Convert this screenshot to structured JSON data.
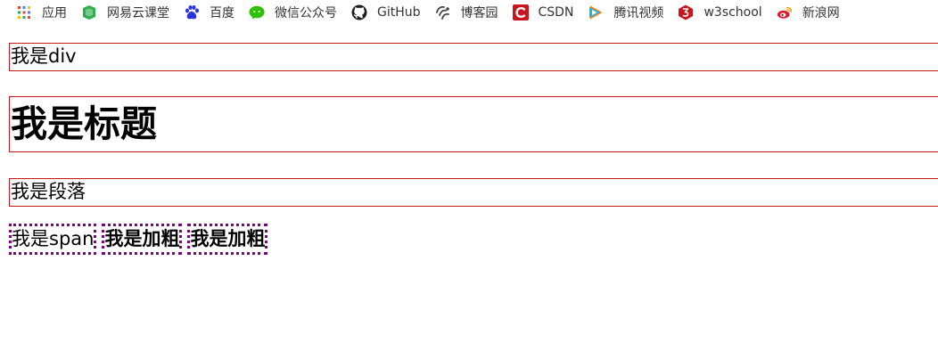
{
  "bookmarks": [
    {
      "label": "应用",
      "icon": "apps-grid-icon"
    },
    {
      "label": "网易云课堂",
      "icon": "netease-study-icon"
    },
    {
      "label": "百度",
      "icon": "baidu-paw-icon"
    },
    {
      "label": "微信公众号",
      "icon": "wechat-icon"
    },
    {
      "label": "GitHub",
      "icon": "github-icon"
    },
    {
      "label": "博客园",
      "icon": "cnblogs-icon"
    },
    {
      "label": "CSDN",
      "icon": "csdn-icon"
    },
    {
      "label": "腾讯视频",
      "icon": "tencent-video-icon"
    },
    {
      "label": "w3school",
      "icon": "w3school-icon"
    },
    {
      "label": "新浪网",
      "icon": "sina-weibo-icon"
    }
  ],
  "content": {
    "div_text": "我是div",
    "heading_text": "我是标题",
    "paragraph_text": "我是段落",
    "span_text": "我是span",
    "bold1_text": "我是加粗",
    "bold2_text": "我是加粗"
  },
  "colors": {
    "block_border": "#c8161d",
    "inline_border": "#800080"
  }
}
